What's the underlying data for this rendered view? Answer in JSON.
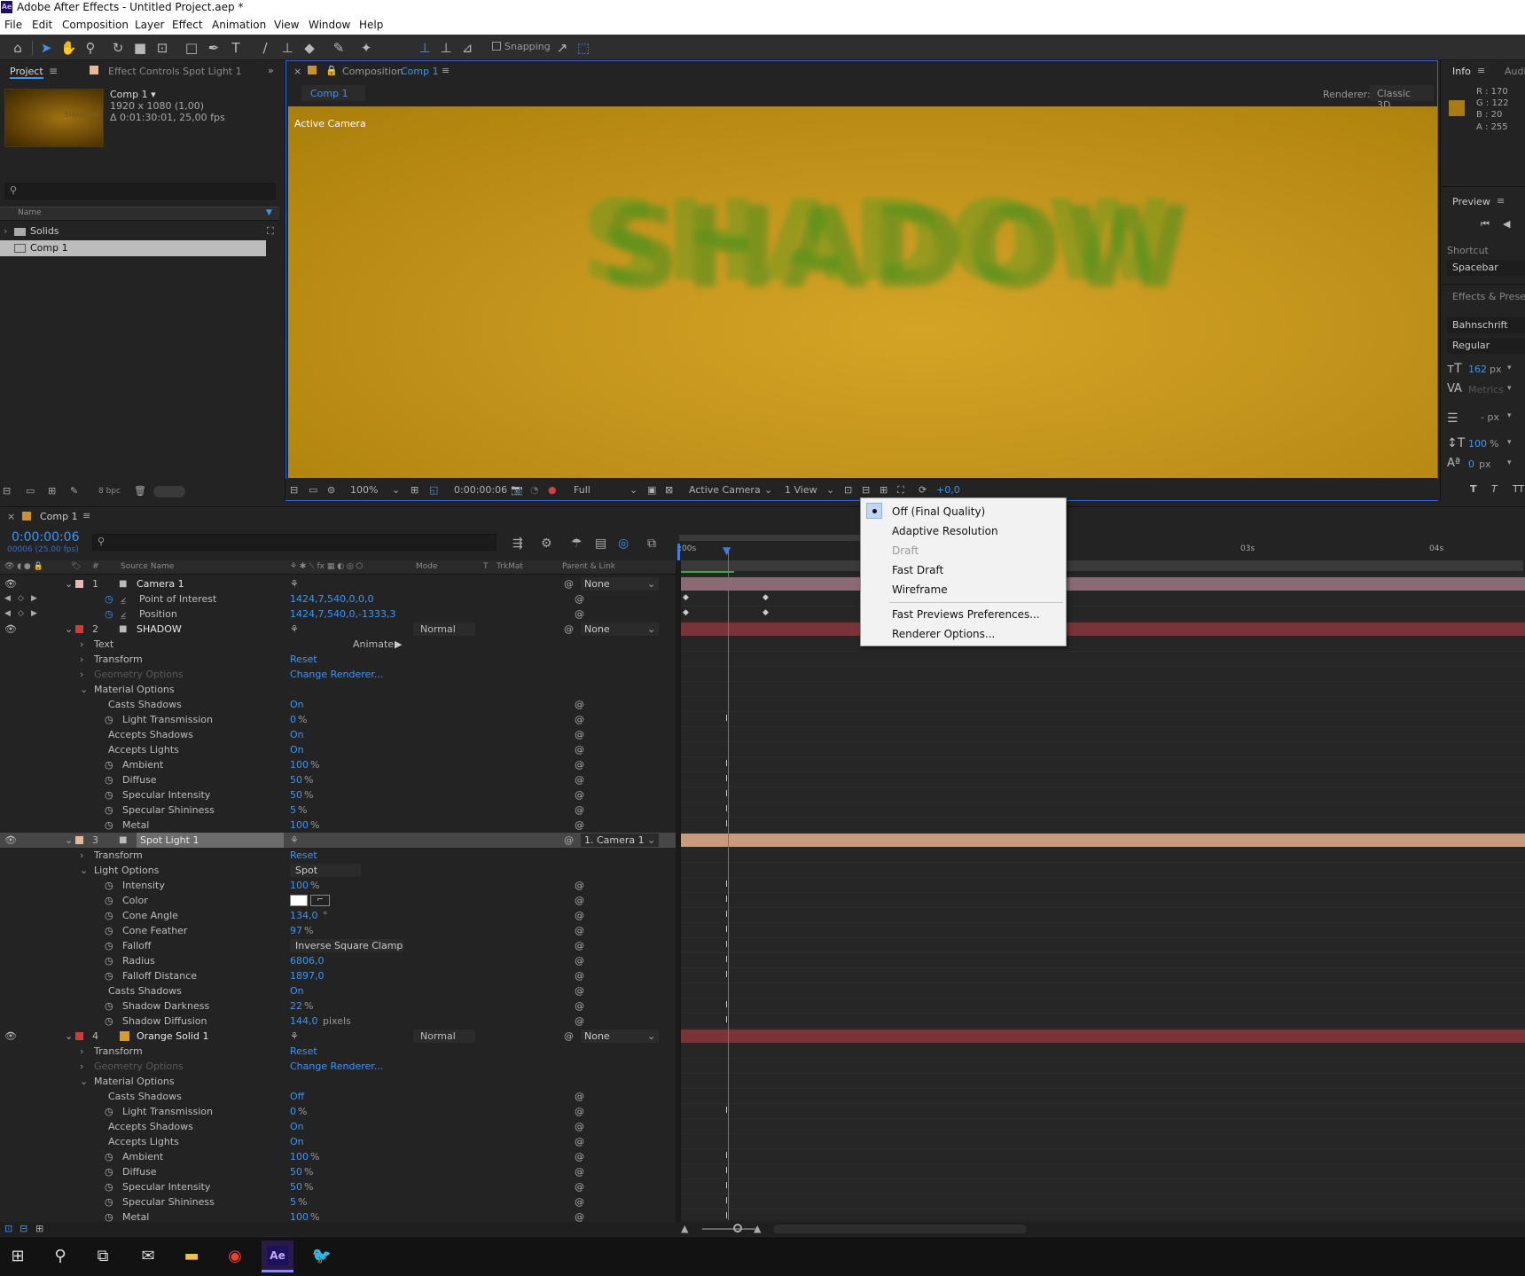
{
  "window": {
    "title": "Adobe After Effects - Untitled Project.aep *",
    "app_icon": "Ae"
  },
  "menu": [
    "File",
    "Edit",
    "Composition",
    "Layer",
    "Effect",
    "Animation",
    "View",
    "Window",
    "Help"
  ],
  "toolbar": {
    "snapping_label": "Snapping"
  },
  "project_panel": {
    "tab_label": "Project",
    "effect_controls_label": "Effect Controls Spot Light 1",
    "comp_name": "Comp 1 ▾",
    "comp_size": "1920 x 1080 (1,00)",
    "comp_duration": "Δ 0:01:30:01, 25,00 fps",
    "thumb_text": "SHADOW",
    "name_header": "Name",
    "items": [
      {
        "label": "Solids"
      },
      {
        "label": "Comp 1"
      }
    ],
    "footer_bpc": "8 bpc"
  },
  "composition_panel": {
    "tab_prefix": "Composition",
    "tab_comp": "Comp 1",
    "subtab": "Comp 1",
    "renderer_label": "Renderer:",
    "renderer_value": "Classic 3D",
    "active_camera_label": "Active Camera",
    "viewer_text": "SHADOW",
    "footer": {
      "zoom": "100%",
      "timecode": "0:00:00:06",
      "resolution": "Full",
      "view": "Active Camera",
      "views": "1 View",
      "exposure": "+0,0"
    }
  },
  "right_panel": {
    "info_tab": "Info",
    "audio_tab": "Audi",
    "color": {
      "r": "R : 170",
      "g": "G : 122",
      "b": "B : 20",
      "a": "A : 255",
      "swatch": "#aa7a14"
    },
    "preview_tab": "Preview",
    "shortcut_label": "Shortcut",
    "shortcut_value": "Spacebar",
    "effects_tab": "Effects & Presets",
    "font": "Bahnschrift",
    "style": "Regular",
    "size": "162",
    "size_unit": "px",
    "tracking": "Metrics",
    "leading": "- px",
    "vscale": "100",
    "vscale_unit": "%",
    "baseline": "0",
    "baseline_unit": "px"
  },
  "renderer_dropdown": {
    "items": [
      {
        "label": "Off (Final Quality)",
        "selected": true,
        "enabled": true
      },
      {
        "label": "Adaptive Resolution",
        "enabled": true
      },
      {
        "label": "Draft",
        "enabled": false
      },
      {
        "label": "Fast Draft",
        "enabled": true
      },
      {
        "label": "Wireframe",
        "enabled": true
      },
      {
        "label": "Fast Previews Preferences...",
        "enabled": true
      },
      {
        "label": "Renderer Options...",
        "enabled": true
      }
    ]
  },
  "timeline": {
    "tab": "Comp 1",
    "timecode": "0:00:00:06",
    "frames": "00006 (25.00 fps)",
    "col_headers": {
      "source": "Source Name",
      "mode": "Mode",
      "t": "T",
      "trkmat": "TrkMat",
      "parent": "Parent & Link"
    },
    "ruler": [
      ":00s",
      "03s",
      "04s"
    ],
    "rows": [
      {
        "kind": "layer",
        "num": "1",
        "name": "Camera 1",
        "color": "#e9b7b7",
        "parent": "None",
        "bar": "#8a6a75"
      },
      {
        "kind": "prop",
        "name": "Point of Interest",
        "value": "1424,7,540,0,0,0",
        "indent": 2
      },
      {
        "kind": "prop",
        "name": "Position",
        "value": "1424,7,540,0,-1333,3",
        "indent": 2
      },
      {
        "kind": "layer",
        "num": "2",
        "name": "SHADOW",
        "color": "#d23a3a",
        "mode": "Normal",
        "parent": "None",
        "bar": "#7a3336"
      },
      {
        "kind": "group",
        "name": "Text",
        "animate": "Animate:"
      },
      {
        "kind": "group",
        "name": "Transform",
        "value": "Reset"
      },
      {
        "kind": "group",
        "name": "Geometry Options",
        "value": "Change Renderer...",
        "dim": true
      },
      {
        "kind": "group",
        "name": "Material Options",
        "open": true
      },
      {
        "kind": "prop",
        "name": "Casts Shadows",
        "value": "On"
      },
      {
        "kind": "prop",
        "name": "Light Transmission",
        "value": "0",
        "unit": "%",
        "stop": true
      },
      {
        "kind": "prop",
        "name": "Accepts Shadows",
        "value": "On"
      },
      {
        "kind": "prop",
        "name": "Accepts Lights",
        "value": "On"
      },
      {
        "kind": "prop",
        "name": "Ambient",
        "value": "100",
        "unit": "%",
        "stop": true
      },
      {
        "kind": "prop",
        "name": "Diffuse",
        "value": "50",
        "unit": "%",
        "stop": true
      },
      {
        "kind": "prop",
        "name": "Specular Intensity",
        "value": "50",
        "unit": "%",
        "stop": true
      },
      {
        "kind": "prop",
        "name": "Specular Shininess",
        "value": "5",
        "unit": "%",
        "stop": true
      },
      {
        "kind": "prop",
        "name": "Metal",
        "value": "100",
        "unit": "%",
        "stop": true
      },
      {
        "kind": "layer",
        "num": "3",
        "name": "Spot Light 1",
        "color": "#e9b79a",
        "parent": "1. Camera 1",
        "bar": "#c99a7c",
        "selected": true
      },
      {
        "kind": "group",
        "name": "Transform",
        "value": "Reset"
      },
      {
        "kind": "group",
        "name": "Light Options",
        "open": true,
        "select": "Spot"
      },
      {
        "kind": "prop",
        "name": "Intensity",
        "value": "100",
        "unit": "%",
        "stop": true
      },
      {
        "kind": "prop",
        "name": "Color",
        "swatch": true,
        "stop": true
      },
      {
        "kind": "prop",
        "name": "Cone Angle",
        "value": "134,0",
        "unit": "°",
        "stop": true
      },
      {
        "kind": "prop",
        "name": "Cone Feather",
        "value": "97",
        "unit": "%",
        "stop": true
      },
      {
        "kind": "prop",
        "name": "Falloff",
        "select": "Inverse Square Clamp",
        "stop": true
      },
      {
        "kind": "prop",
        "name": "Radius",
        "value": "6806,0",
        "stop": true
      },
      {
        "kind": "prop",
        "name": "Falloff Distance",
        "value": "1897,0",
        "stop": true
      },
      {
        "kind": "prop",
        "name": "Casts Shadows",
        "value": "On"
      },
      {
        "kind": "prop",
        "name": "Shadow Darkness",
        "value": "22",
        "unit": "%",
        "stop": true
      },
      {
        "kind": "prop",
        "name": "Shadow Diffusion",
        "value": "144,0",
        "unit": "pixels",
        "stop": true
      },
      {
        "kind": "layer",
        "num": "4",
        "name": "Orange Solid 1",
        "color": "#d23a3a",
        "swatch2": "#d99a2a",
        "mode": "Normal",
        "parent": "None",
        "bar": "#7a3336"
      },
      {
        "kind": "group",
        "name": "Transform",
        "value": "Reset"
      },
      {
        "kind": "group",
        "name": "Geometry Options",
        "value": "Change Renderer...",
        "dim": true
      },
      {
        "kind": "group",
        "name": "Material Options",
        "open": true
      },
      {
        "kind": "prop",
        "name": "Casts Shadows",
        "value": "Off"
      },
      {
        "kind": "prop",
        "name": "Light Transmission",
        "value": "0",
        "unit": "%",
        "stop": true
      },
      {
        "kind": "prop",
        "name": "Accepts Shadows",
        "value": "On"
      },
      {
        "kind": "prop",
        "name": "Accepts Lights",
        "value": "On"
      },
      {
        "kind": "prop",
        "name": "Ambient",
        "value": "100",
        "unit": "%",
        "stop": true
      },
      {
        "kind": "prop",
        "name": "Diffuse",
        "value": "50",
        "unit": "%",
        "stop": true
      },
      {
        "kind": "prop",
        "name": "Specular Intensity",
        "value": "50",
        "unit": "%",
        "stop": true
      },
      {
        "kind": "prop",
        "name": "Specular Shininess",
        "value": "5",
        "unit": "%",
        "stop": true
      },
      {
        "kind": "prop",
        "name": "Metal",
        "value": "100",
        "unit": "%",
        "stop": true
      }
    ]
  },
  "taskbar": {
    "items": [
      "windows-icon",
      "search-icon",
      "task-view-icon",
      "mail-icon",
      "folder-icon",
      "chrome-icon",
      "after-effects-icon",
      "bird-app-icon"
    ],
    "ae_label": "Ae"
  }
}
